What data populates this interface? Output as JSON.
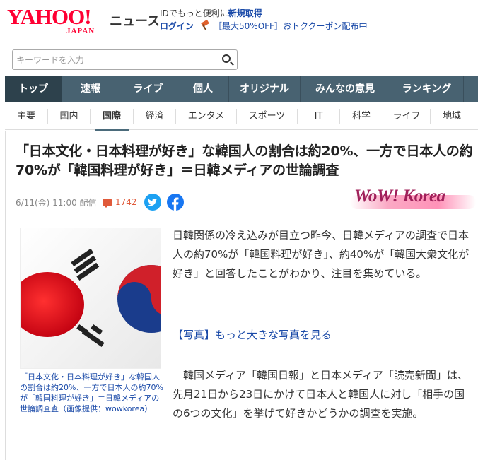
{
  "header": {
    "logo_main": "YAHOO!",
    "logo_sub": "JAPAN",
    "service_name": "ニュース",
    "promo_line1_prefix": "IDでもっと便利に",
    "promo_line1_link": "新規取得",
    "login": "ログイン",
    "coupon": "［最大50%OFF］おトククーポン配布中"
  },
  "search": {
    "placeholder": "キーワードを入力"
  },
  "nav": {
    "items": [
      {
        "label": "トップ"
      },
      {
        "label": "速報"
      },
      {
        "label": "ライブ"
      },
      {
        "label": "個人"
      },
      {
        "label": "オリジナル"
      },
      {
        "label": "みんなの意見"
      },
      {
        "label": "ランキング"
      }
    ]
  },
  "subnav": {
    "items": [
      {
        "label": "主要"
      },
      {
        "label": "国内"
      },
      {
        "label": "国際"
      },
      {
        "label": "経済"
      },
      {
        "label": "エンタメ"
      },
      {
        "label": "スポーツ"
      },
      {
        "label": "IT"
      },
      {
        "label": "科学"
      },
      {
        "label": "ライフ"
      },
      {
        "label": "地域"
      }
    ],
    "active": "国際"
  },
  "article": {
    "title": "「日本文化・日本料理が好き」な韓国人の割合は約20%、一方で日本人の約70%が「韓国料理が好き」＝日韓メディアの世論調査",
    "meta": "6/11(金) 11:00 配信",
    "comment_count": "1742",
    "source": "WoW! Korea",
    "caption": "「日本文化・日本料理が好き」な韓国人の割合は約20%、一方で日本人の約70%が「韓国料理が好き」＝日韓メディアの世論調査査（画像提供：wowkorea）",
    "paragraph1": "日韓関係の冷え込みが目立つ昨今、日韓メディアの調査で日本人の約70%が「韓国料理が好き」、約40%が「韓国大衆文化が好き」と回答したことがわかり、注目を集めている。",
    "photo_link": "【写真】もっと大きな写真を見る",
    "paragraph2": "韓国メディア「韓国日報」と日本メディア「読売新聞」は、先月21日から23日にかけて日本人と韓国人に対し「相手の国の6つの文化」を挙げて好きかどうかの調査を実施。"
  }
}
